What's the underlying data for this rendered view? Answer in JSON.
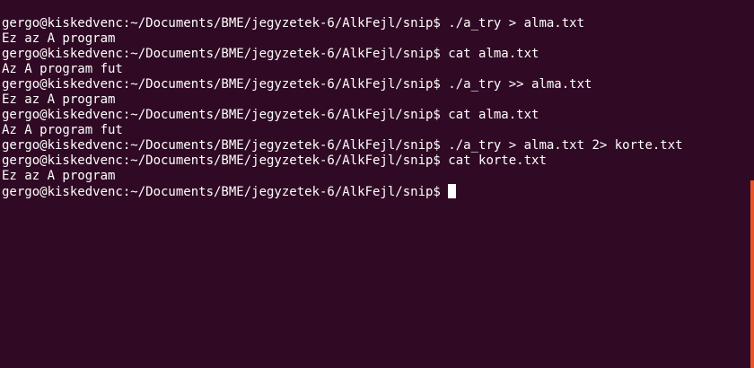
{
  "terminal": {
    "lines": [
      {
        "text": "gergo@kiskedvenc:~/Documents/BME/jegyzetek-6/AlkFejl/snip$ ./a_try > alma.txt"
      },
      {
        "text": "Ez az A program"
      },
      {
        "text": "gergo@kiskedvenc:~/Documents/BME/jegyzetek-6/AlkFejl/snip$ cat alma.txt"
      },
      {
        "text": "Az A program fut"
      },
      {
        "text": "gergo@kiskedvenc:~/Documents/BME/jegyzetek-6/AlkFejl/snip$ ./a_try >> alma.txt"
      },
      {
        "text": "Ez az A program"
      },
      {
        "text": "gergo@kiskedvenc:~/Documents/BME/jegyzetek-6/AlkFejl/snip$ cat alma.txt"
      },
      {
        "text": "Az A program fut"
      },
      {
        "text": "gergo@kiskedvenc:~/Documents/BME/jegyzetek-6/AlkFejl/snip$ ./a_try > alma.txt 2> korte.txt"
      },
      {
        "text": "gergo@kiskedvenc:~/Documents/BME/jegyzetek-6/AlkFejl/snip$ cat korte.txt"
      },
      {
        "text": "Ez az A program"
      }
    ],
    "prompt": "gergo@kiskedvenc:~/Documents/BME/jegyzetek-6/AlkFejl/snip$ "
  },
  "colors": {
    "background": "#300a24",
    "foreground": "#ffffff",
    "scrollbar": "#e9542a"
  }
}
